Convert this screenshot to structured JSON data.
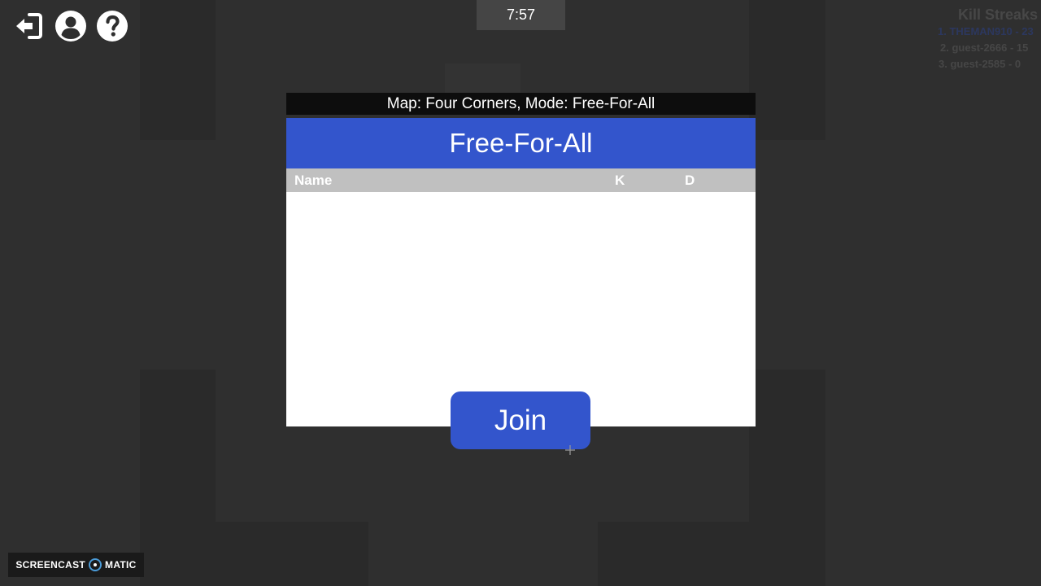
{
  "hud": {
    "timer": "7:57",
    "icons": [
      "logout-icon",
      "profile-icon",
      "help-icon"
    ]
  },
  "kill_streaks": {
    "title": "Kill Streaks",
    "entries": [
      "1. THEMAN910 - 23",
      "2. guest-2666 - 15",
      "3. guest-2585 - 0"
    ]
  },
  "lobby": {
    "map_mode": "Map: Four Corners, Mode: Free-For-All",
    "title": "Free-For-All",
    "columns": {
      "name": "Name",
      "kills": "K",
      "deaths": "D"
    },
    "rows": [],
    "join_label": "Join"
  },
  "watermark": {
    "left": "SCREENCAST",
    "right": "MATIC"
  },
  "colors": {
    "background": "#2f2f2f",
    "accent": "#3355cc",
    "header_bar": "#c0c0c0"
  }
}
